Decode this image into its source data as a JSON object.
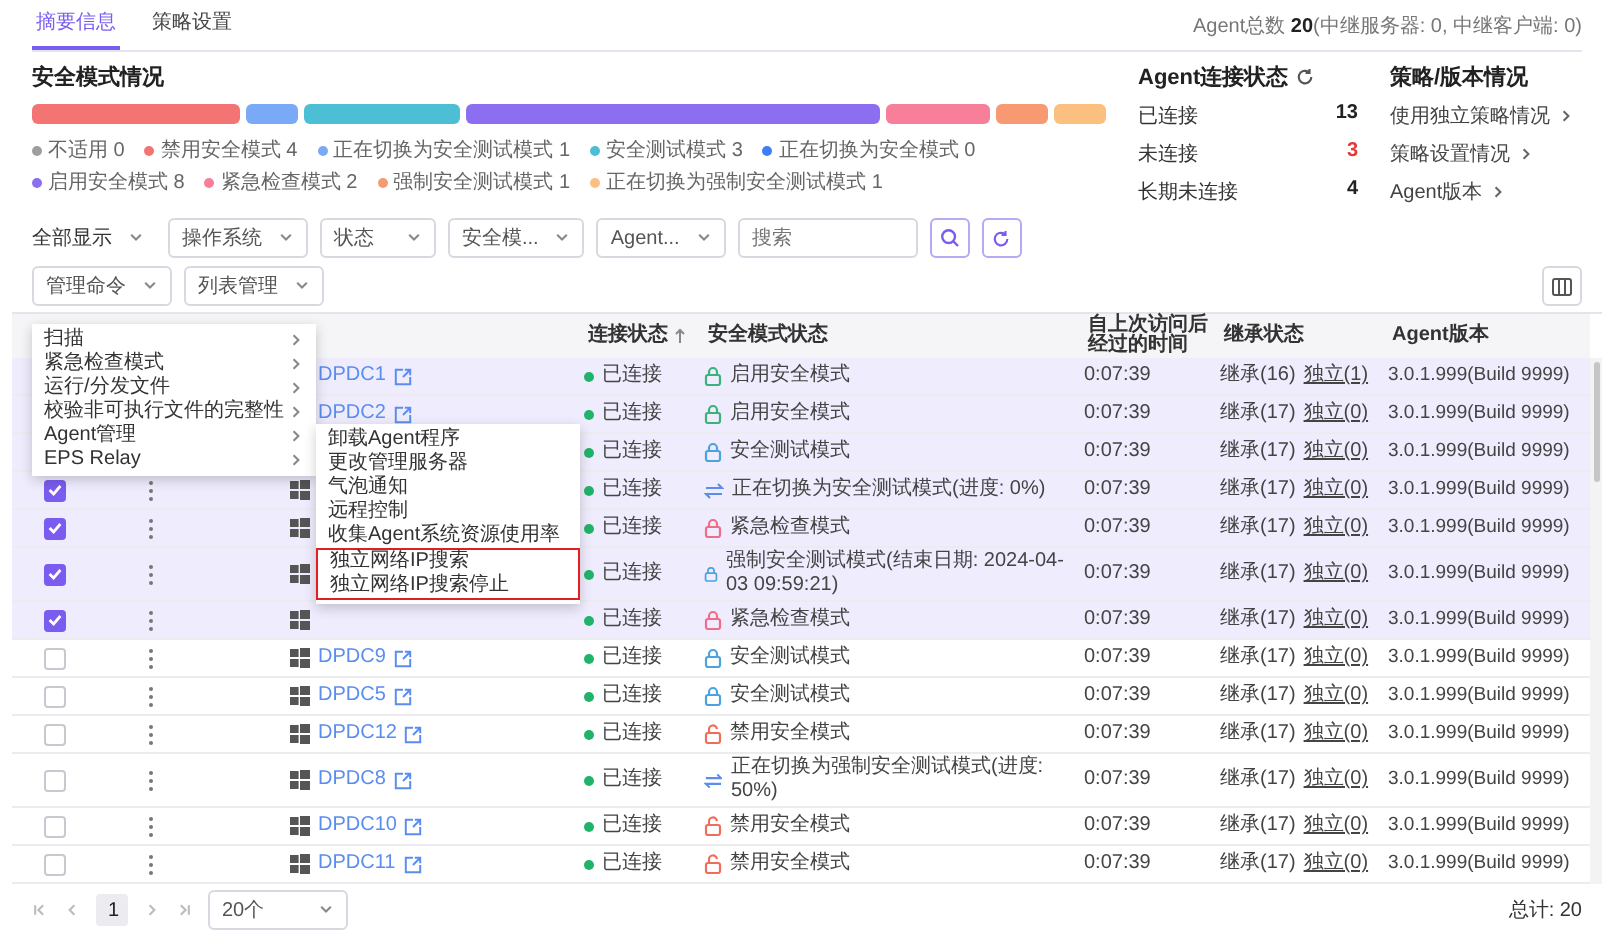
{
  "tabs": [
    {
      "label": "摘要信息",
      "selected": true
    },
    {
      "label": "策略设置",
      "selected": false
    }
  ],
  "agent_total": "Agent总数 **20**(中继服务器: 0, 中继客户端: 0)",
  "security_overview": {
    "title": "安全模式情况",
    "segments": [
      {
        "label": "不适用",
        "count": "0",
        "color": "#9e9e9e"
      },
      {
        "label": "禁用安全模式",
        "count": "4",
        "color": "#f47373"
      },
      {
        "label": "正在切换为安全测试模式",
        "count": "1",
        "color": "#7aaaf5"
      },
      {
        "label": "安全测试模式",
        "count": "3",
        "color": "#4dbfd4"
      },
      {
        "label": "正在切换为安全模式",
        "count": "0",
        "color": "#3d7ef5"
      },
      {
        "label": "启用安全模式",
        "count": "8",
        "color": "#8b6ff0"
      },
      {
        "label": "紧急检查模式",
        "count": "2",
        "color": "#f77f9a"
      },
      {
        "label": "强制安全测试模式",
        "count": "1",
        "color": "#f79a72"
      },
      {
        "label": "正在切换为强制安全测试模式",
        "count": "1",
        "color": "#fbbf80"
      }
    ]
  },
  "connection": {
    "title": "Agent连接状态",
    "items": [
      {
        "label": "已连接",
        "value": "13",
        "color": "#222222"
      },
      {
        "label": "未连接",
        "value": "3",
        "color": "#e53935"
      },
      {
        "label": "长期未连接",
        "value": "4",
        "color": "#222222"
      }
    ]
  },
  "policy": {
    "title": "策略/版本情况",
    "links": [
      "使用独立策略情况",
      "策略设置情况",
      "Agent版本"
    ]
  },
  "filters": {
    "display": "全部显示",
    "selects": [
      "操作系统",
      "状态",
      "安全模...",
      "Agent..."
    ],
    "search_placeholder": "搜索"
  },
  "actions": [
    {
      "label": "管理命令",
      "menu": [
        {
          "label": "扫描"
        },
        {
          "label": "紧急检查模式"
        },
        {
          "label": "运行/分发文件"
        },
        {
          "label": "校验非可执行文件的完整性"
        },
        {
          "label": "Agent管理",
          "submenu": [
            {
              "label": "卸载Agent程序",
              "highlighted": false
            },
            {
              "label": "更改管理服务器",
              "highlighted": false
            },
            {
              "label": "气泡通知",
              "highlighted": false
            },
            {
              "label": "远程控制",
              "highlighted": false
            },
            {
              "label": "收集Agent系统资源使用率",
              "highlighted": false
            },
            {
              "label": "独立网络IP搜索",
              "highlighted": true
            },
            {
              "label": "独立网络IP搜索停止",
              "highlighted": true
            }
          ]
        },
        {
          "label": "EPS Relay"
        }
      ]
    },
    {
      "label": "列表管理"
    }
  ],
  "columns": [
    {
      "label": "连接状态",
      "sorted": true
    },
    {
      "label": "安全模式状态",
      "sorted": false
    },
    {
      "label": "自上次访问后经过的时间",
      "sorted": false
    },
    {
      "label": "继承状态",
      "sorted": false
    },
    {
      "label": "Agent版本",
      "sorted": false
    }
  ],
  "rows": [
    {
      "selected": true,
      "name": "DPDC1",
      "status": "已连接",
      "connected": true,
      "mode": {
        "kind": "enabled",
        "text": "启用安全模式"
      },
      "elapsed": "0:07:39",
      "inherit": "继承(16)",
      "independent": "独立(1)",
      "version": "3.0.1.999(Build 9999)"
    },
    {
      "selected": true,
      "name": "DPDC2",
      "status": "已连接",
      "connected": true,
      "mode": {
        "kind": "enabled",
        "text": "启用安全模式"
      },
      "elapsed": "0:07:39",
      "inherit": "继承(17)",
      "independent": "独立(0)",
      "version": "3.0.1.999(Build 9999)"
    },
    {
      "selected": true,
      "status": "已连接",
      "connected": true,
      "mode": {
        "kind": "test",
        "text": "安全测试模式"
      },
      "elapsed": "0:07:39",
      "inherit": "继承(17)",
      "independent": "独立(0)",
      "version": "3.0.1.999(Build 9999)"
    },
    {
      "selected": true,
      "checked": true,
      "os": {
        "kind": "windows"
      },
      "status": "已连接",
      "connected": true,
      "mode": {
        "kind": "switching",
        "text": "正在切换为安全测试模式(进度: 0%)"
      },
      "elapsed": "0:07:39",
      "inherit": "继承(17)",
      "independent": "独立(0)",
      "version": "3.0.1.999(Build 9999)"
    },
    {
      "selected": true,
      "checked": true,
      "os": {
        "kind": "windows"
      },
      "status": "已连接",
      "connected": true,
      "mode": {
        "kind": "emergency",
        "text": "紧急检查模式"
      },
      "elapsed": "0:07:39",
      "inherit": "继承(17)",
      "independent": "独立(0)",
      "version": "3.0.1.999(Build 9999)"
    },
    {
      "selected": true,
      "checked": true,
      "os": {
        "kind": "windows"
      },
      "status": "已连接",
      "connected": true,
      "mode": {
        "kind": "forced",
        "text": "强制安全测试模式(结束日期: 2024-04-03 09:59:21)"
      },
      "elapsed": "0:07:39",
      "inherit": "继承(17)",
      "independent": "独立(0)",
      "version": "3.0.1.999(Build 9999)"
    },
    {
      "selected": true,
      "checked": true,
      "os": {
        "kind": "windows"
      },
      "status": "已连接",
      "connected": true,
      "mode": {
        "kind": "emergency",
        "text": "紧急检查模式"
      },
      "elapsed": "0:07:39",
      "inherit": "继承(17)",
      "independent": "独立(0)",
      "version": "3.0.1.999(Build 9999)"
    },
    {
      "selected": false,
      "checked": false,
      "os": {
        "kind": "windows"
      },
      "name": "DPDC9",
      "status": "已连接",
      "connected": true,
      "mode": {
        "kind": "test",
        "text": "安全测试模式"
      },
      "elapsed": "0:07:39",
      "inherit": "继承(17)",
      "independent": "独立(0)",
      "version": "3.0.1.999(Build 9999)"
    },
    {
      "selected": false,
      "checked": false,
      "os": {
        "kind": "windows"
      },
      "name": "DPDC5",
      "status": "已连接",
      "connected": true,
      "mode": {
        "kind": "test",
        "text": "安全测试模式"
      },
      "elapsed": "0:07:39",
      "inherit": "继承(17)",
      "independent": "独立(0)",
      "version": "3.0.1.999(Build 9999)"
    },
    {
      "selected": false,
      "checked": false,
      "os": {
        "kind": "windows"
      },
      "name": "DPDC12",
      "status": "已连接",
      "connected": true,
      "mode": {
        "kind": "disabled",
        "text": "禁用安全模式"
      },
      "elapsed": "0:07:39",
      "inherit": "继承(17)",
      "independent": "独立(0)",
      "version": "3.0.1.999(Build 9999)"
    },
    {
      "selected": false,
      "checked": false,
      "os": {
        "kind": "windows"
      },
      "name": "DPDC8",
      "status": "已连接",
      "connected": true,
      "mode": {
        "kind": "switching",
        "text": "正在切换为强制安全测试模式(进度: 50%)"
      },
      "elapsed": "0:07:39",
      "inherit": "继承(17)",
      "independent": "独立(0)",
      "version": "3.0.1.999(Build 9999)"
    },
    {
      "selected": false,
      "checked": false,
      "os": {
        "kind": "windows"
      },
      "name": "DPDC10",
      "status": "已连接",
      "connected": true,
      "mode": {
        "kind": "disabled",
        "text": "禁用安全模式"
      },
      "elapsed": "0:07:39",
      "inherit": "继承(17)",
      "independent": "独立(0)",
      "version": "3.0.1.999(Build 9999)"
    },
    {
      "selected": false,
      "checked": false,
      "os": {
        "kind": "windows"
      },
      "name": "DPDC11",
      "status": "已连接",
      "connected": true,
      "mode": {
        "kind": "disabled",
        "text": "禁用安全模式"
      },
      "elapsed": "0:07:39",
      "inherit": "继承(17)",
      "independent": "独立(0)",
      "version": "3.0.1.999(Build 9999)"
    }
  ],
  "pagination": {
    "pages": [
      {
        "label": "1",
        "selected": true
      }
    ],
    "page_size": "20个",
    "total": "总计: 20"
  }
}
